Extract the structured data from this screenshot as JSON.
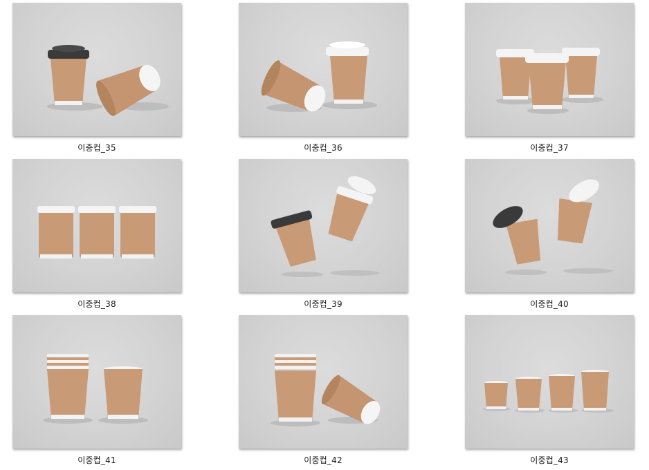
{
  "files": [
    {
      "name": "이중컵_35",
      "cups": "2 cups, one with black lid, one lying on side"
    },
    {
      "name": "이중컵_36",
      "cups": "cup lying on side, cup with white lid"
    },
    {
      "name": "이중컵_37",
      "cups": "3 cups with white lids"
    },
    {
      "name": "이중컵_38",
      "cups": "3 cups top view with white lids"
    },
    {
      "name": "이중컵_39",
      "cups": "2 floating cups"
    },
    {
      "name": "이중컵_40",
      "cups": "2 floating cups with floating lids"
    },
    {
      "name": "이중컵_41",
      "cups": "stack and single cup"
    },
    {
      "name": "이중컵_42",
      "cups": "stack and cup on side"
    },
    {
      "name": "이중컵_43",
      "cups": "4 cups of increasing size"
    }
  ],
  "colors": {
    "kraft": "#c99a76",
    "kraft_dark": "#b3855f",
    "lid_white": "#f4f4f4",
    "lid_black": "#3a3a3a",
    "background": "#d6d6d6"
  }
}
